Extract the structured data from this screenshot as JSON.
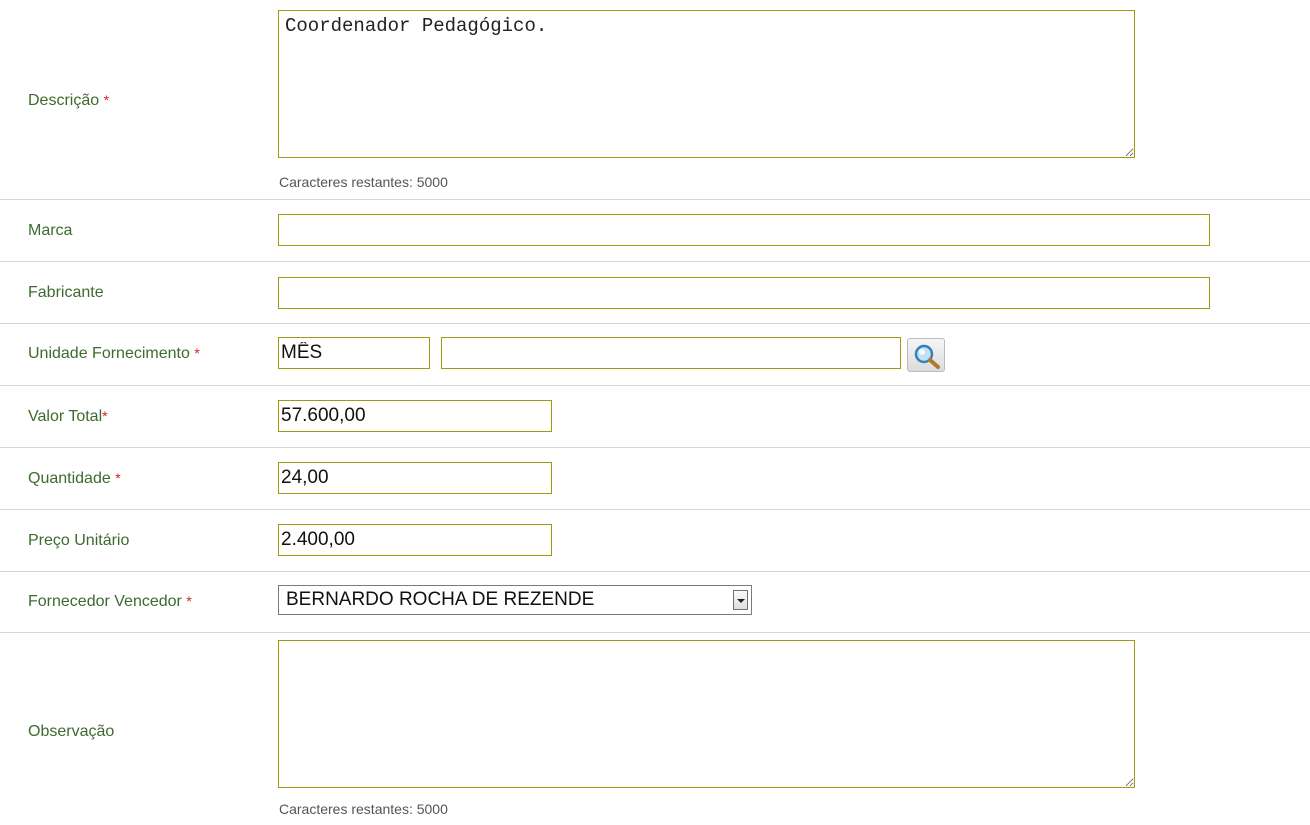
{
  "form": {
    "descricao": {
      "label": "Descrição",
      "required_mark": "*",
      "value": "Coordenador Pedagógico.",
      "counter_label": "Caracteres restantes:",
      "counter_value": "5000"
    },
    "marca": {
      "label": "Marca",
      "value": ""
    },
    "fabricante": {
      "label": "Fabricante",
      "value": ""
    },
    "unidade_fornecimento": {
      "label": "Unidade Fornecimento",
      "required_mark": "*",
      "code_value": "MÊS",
      "description_value": "",
      "lookup_icon": "magnifier-icon"
    },
    "valor_total": {
      "label": "Valor Total",
      "required_mark": "*",
      "value": "57.600,00"
    },
    "quantidade": {
      "label": "Quantidade",
      "required_mark": "*",
      "value": "24,00"
    },
    "preco_unitario": {
      "label": "Preço Unitário",
      "value": "2.400,00"
    },
    "fornecedor_vencedor": {
      "label": "Fornecedor Vencedor",
      "required_mark": "*",
      "selected": "BERNARDO ROCHA DE REZENDE"
    },
    "observacao": {
      "label": "Observação",
      "value": "",
      "counter_label": "Caracteres restantes:",
      "counter_value": "5000"
    }
  },
  "colors": {
    "label": "#3d6b2e",
    "required": "#d42020",
    "field_border": "#a09a10",
    "row_separator": "#d5d5d5"
  }
}
